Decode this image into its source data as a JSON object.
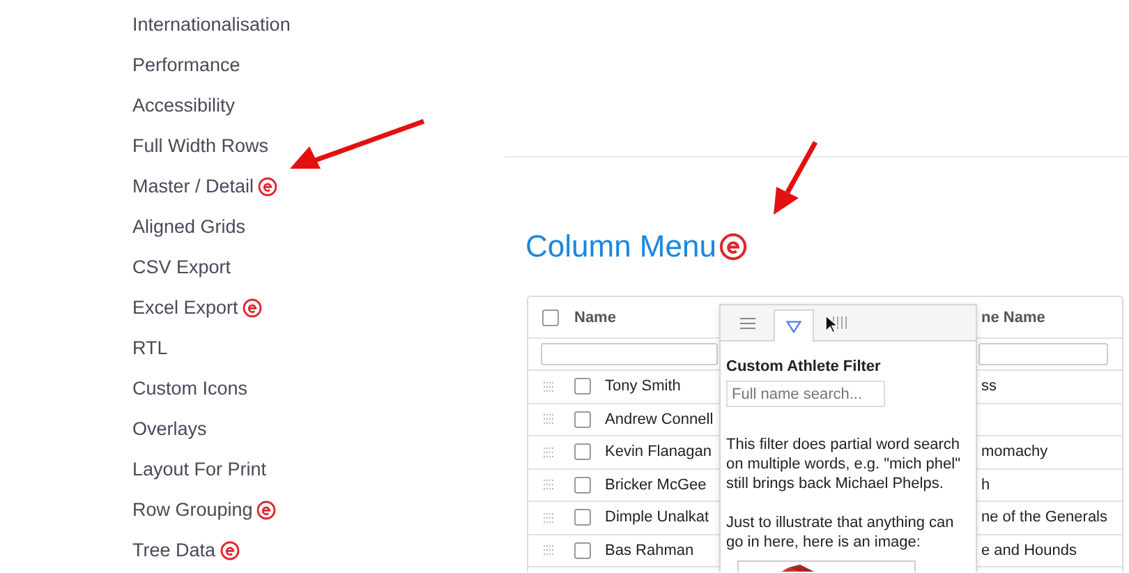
{
  "sidebar": {
    "items": [
      {
        "label": "Internationalisation",
        "enterprise": false
      },
      {
        "label": "Performance",
        "enterprise": false
      },
      {
        "label": "Accessibility",
        "enterprise": false
      },
      {
        "label": "Full Width Rows",
        "enterprise": false
      },
      {
        "label": "Master / Detail",
        "enterprise": true
      },
      {
        "label": "Aligned Grids",
        "enterprise": false
      },
      {
        "label": "CSV Export",
        "enterprise": false
      },
      {
        "label": "Excel Export",
        "enterprise": true
      },
      {
        "label": "RTL",
        "enterprise": false
      },
      {
        "label": "Custom Icons",
        "enterprise": false
      },
      {
        "label": "Overlays",
        "enterprise": false
      },
      {
        "label": "Layout For Print",
        "enterprise": false
      },
      {
        "label": "Row Grouping",
        "enterprise": true
      },
      {
        "label": "Tree Data",
        "enterprise": true
      }
    ]
  },
  "section": {
    "title": "Column Menu",
    "enterprise": true
  },
  "grid": {
    "header_checked": false,
    "columns": [
      {
        "label": "Name"
      },
      {
        "label": "ne Name"
      }
    ],
    "rows": [
      {
        "name": "Tony Smith",
        "column_2": "ss",
        "checked": false
      },
      {
        "name": "Andrew Connell",
        "checked": false
      },
      {
        "name": "Kevin Flanagan",
        "column_2": "momachy",
        "checked": false
      },
      {
        "name": "Bricker McGee",
        "column_2": "h",
        "checked": false
      },
      {
        "name": "Dimple Unalkat",
        "column_2": "ne of the Generals",
        "checked": false
      },
      {
        "name": "Bas Rahman",
        "column_2": "e and Hounds",
        "checked": false
      }
    ]
  },
  "column_menu": {
    "tabs": [
      {
        "kind": "menu",
        "selected": false
      },
      {
        "kind": "filter",
        "selected": true
      },
      {
        "kind": "columns",
        "selected": false
      }
    ],
    "filter_title": "Custom Athlete Filter",
    "search": {
      "placeholder": "Full name search..."
    },
    "paragraphs": [
      "This filter does partial word search on multiple words, e.g. \"mich phel\" still brings back Michael Phelps.",
      "Just to illustrate that anything can go in here, here is an image:"
    ],
    "image": {
      "kind": "picture"
    }
  }
}
